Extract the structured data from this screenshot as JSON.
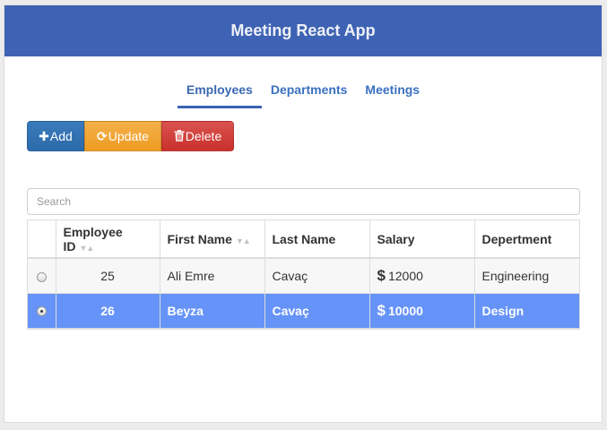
{
  "header": {
    "title": "Meeting React App"
  },
  "tabs": [
    {
      "label": "Employees",
      "active": true
    },
    {
      "label": "Departments",
      "active": false
    },
    {
      "label": "Meetings",
      "active": false
    }
  ],
  "toolbar": {
    "add_label": "Add",
    "update_label": "Update",
    "delete_label": "Delete",
    "colors": {
      "add": "#2c6aa8",
      "update": "#ee9c22",
      "delete": "#c9302c"
    }
  },
  "search": {
    "placeholder": "Search",
    "value": ""
  },
  "table": {
    "columns": [
      "Employee ID",
      "First Name",
      "Last Name",
      "Salary",
      "Depertment"
    ],
    "rows": [
      {
        "id": "25",
        "first": "Ali Emre",
        "last": "Cavaç",
        "currency": "$",
        "salary": "12000",
        "department": "Engineering",
        "selected": false
      },
      {
        "id": "26",
        "first": "Beyza",
        "last": "Cavaç",
        "currency": "$",
        "salary": "10000",
        "department": "Design",
        "selected": true
      }
    ],
    "selected_color": "#6693f8"
  },
  "header_color": "#3f63b4"
}
